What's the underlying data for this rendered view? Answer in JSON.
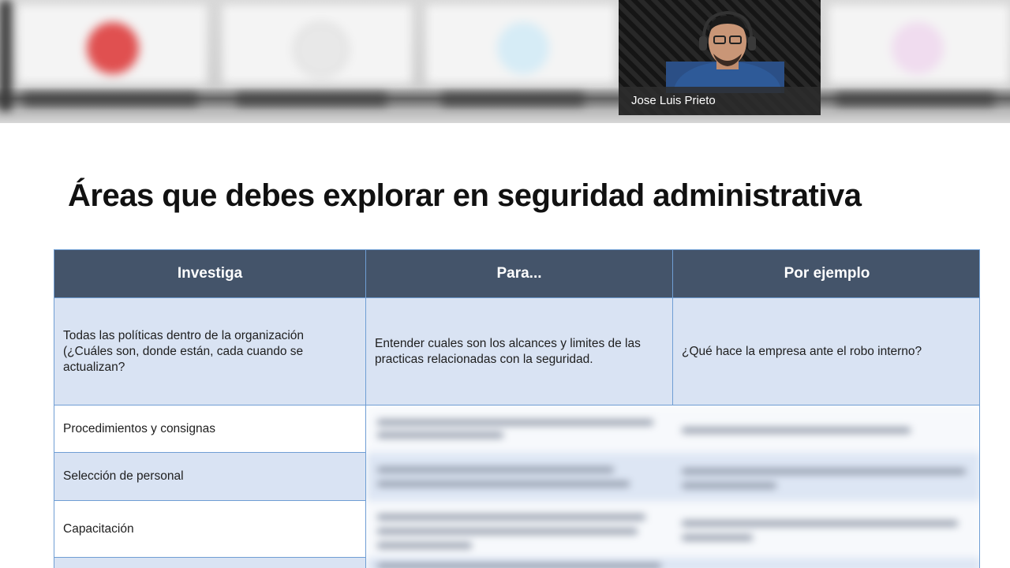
{
  "participant": {
    "name": "Jose Luis Prieto"
  },
  "slide": {
    "title": "Áreas que debes explorar en seguridad administrativa",
    "table": {
      "headers": [
        "Investiga",
        "Para...",
        "Por ejemplo"
      ],
      "first_row": {
        "investiga": "Todas las políticas dentro de la organización (¿Cuáles son, donde están, cada cuando se actualizan?",
        "para": "Entender cuales son los alcances y limites de las practicas relacionadas con la seguridad.",
        "ejemplo": "¿Qué hace la empresa ante el robo interno?"
      },
      "rows": [
        "Procedimientos y consignas",
        "Selección de personal",
        "Capacitación"
      ]
    }
  },
  "colors": {
    "header_bg": "#44546a",
    "row_tint": "#d9e3f3",
    "border": "#6f9ed4"
  }
}
